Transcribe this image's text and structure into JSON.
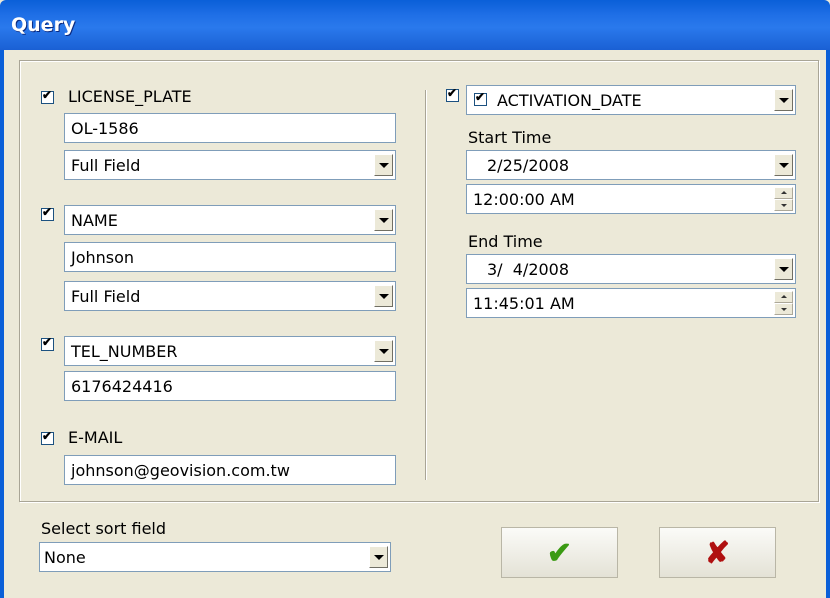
{
  "window": {
    "title": "Query"
  },
  "left": {
    "license_plate": {
      "label": "LICENSE_PLATE",
      "value": "OL-1586",
      "match": "Full Field"
    },
    "name": {
      "field": "NAME",
      "value": "Johnson",
      "match": "Full Field"
    },
    "tel": {
      "field": "TEL_NUMBER",
      "value": "6176424416"
    },
    "email": {
      "label": "E-MAIL",
      "value": "johnson@geovision.com.tw"
    }
  },
  "right": {
    "date_field": "ACTIVATION_DATE",
    "start": {
      "label": "Start Time",
      "date": "2/25/2008",
      "time": "12:00:00 AM"
    },
    "end": {
      "label": "End Time",
      "date": "3/  4/2008",
      "time": "11:45:01 AM"
    }
  },
  "sort": {
    "label": "Select sort field",
    "value": "None"
  },
  "buttons": {
    "ok_symbol": "✔",
    "cancel_symbol": "✘"
  },
  "icons": {
    "ok": "green-checkmark-icon",
    "cancel": "red-x-icon"
  }
}
